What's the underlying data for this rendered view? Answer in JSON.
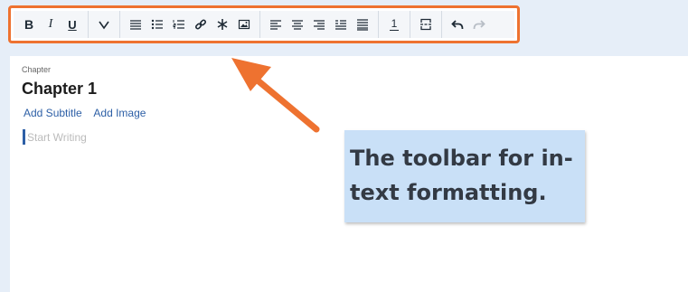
{
  "toolbar": {
    "buttons": [
      {
        "name": "bold",
        "icon": "bold-icon"
      },
      {
        "name": "italic",
        "icon": "italic-icon"
      },
      {
        "name": "underline",
        "icon": "underline-icon"
      },
      {
        "name": "more-formatting",
        "icon": "chevron-down-icon"
      },
      {
        "name": "paragraph",
        "icon": "paragraph-icon"
      },
      {
        "name": "bulleted-list",
        "icon": "bullet-list-icon"
      },
      {
        "name": "numbered-list",
        "icon": "numbered-list-icon"
      },
      {
        "name": "link",
        "icon": "link-icon"
      },
      {
        "name": "asterisk",
        "icon": "asterisk-icon"
      },
      {
        "name": "image",
        "icon": "image-icon"
      },
      {
        "name": "align-left",
        "icon": "align-left-icon"
      },
      {
        "name": "align-center",
        "icon": "align-center-icon"
      },
      {
        "name": "align-right",
        "icon": "align-right-icon"
      },
      {
        "name": "indent",
        "icon": "indent-icon"
      },
      {
        "name": "justify",
        "icon": "justify-icon"
      },
      {
        "name": "footnote",
        "icon": "footnote-icon"
      },
      {
        "name": "page-break",
        "icon": "page-break-icon"
      },
      {
        "name": "undo",
        "icon": "undo-icon"
      },
      {
        "name": "redo",
        "icon": "redo-icon"
      }
    ],
    "footnote_label": "1",
    "border_color": "#ee7230"
  },
  "editor": {
    "chapter_label": "Chapter",
    "chapter_title": "Chapter 1",
    "add_subtitle": "Add Subtitle",
    "add_image": "Add Image",
    "placeholder": "Start Writing"
  },
  "annotation": {
    "text": "The toolbar for in-text formatting.",
    "arrow_color": "#ee7230",
    "background": "#c9e0f7"
  }
}
